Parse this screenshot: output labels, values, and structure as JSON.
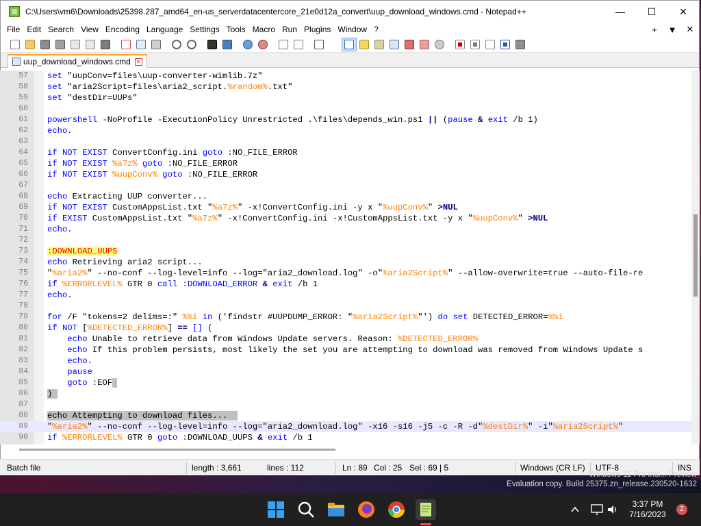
{
  "window": {
    "title": "C:\\Users\\vm6\\Downloads\\25398.287_amd64_en-us_serverdatacentercore_21e0d12a_convert\\uup_download_windows.cmd - Notepad++",
    "minimize": "—",
    "maximize": "☐",
    "close": "✕"
  },
  "menu": {
    "items": [
      "File",
      "Edit",
      "Search",
      "View",
      "Encoding",
      "Language",
      "Settings",
      "Tools",
      "Macro",
      "Run",
      "Plugins",
      "Window",
      "?"
    ],
    "right": [
      "+",
      "▼",
      "✕"
    ]
  },
  "toolbar": {
    "icons": [
      "new-file-icon",
      "open-file-icon",
      "save-icon",
      "save-all-icon",
      "close-icon",
      "close-all-icon",
      "print-icon",
      "cut-icon",
      "copy-icon",
      "paste-icon",
      "undo-icon",
      "redo-icon",
      "find-icon",
      "replace-icon",
      "zoom-in-icon",
      "zoom-out-icon",
      "sync-vertical-icon",
      "sync-horizontal-icon",
      "word-wrap-icon",
      "show-all-chars-icon",
      "indent-guide-icon",
      "udl-icon",
      "doc-map-icon",
      "function-list-icon",
      "folder-workspace-icon",
      "monitor-icon",
      "record-macro-icon",
      "stop-macro-icon",
      "play-macro-icon",
      "run-macro-multiple-icon",
      "save-macro-icon"
    ]
  },
  "tab": {
    "label": "uup_download_windows.cmd",
    "close": "✕"
  },
  "editor": {
    "lines": [
      {
        "n": "57",
        "segs": [
          [
            "kw",
            "set"
          ],
          [
            "t",
            " \"uupConv=files\\uup-converter-wimlib.7z\""
          ]
        ]
      },
      {
        "n": "58",
        "segs": [
          [
            "kw",
            "set"
          ],
          [
            "t",
            " \"aria2Script=files\\aria2_script."
          ],
          [
            "var",
            "%random%"
          ],
          [
            "t",
            ".txt\""
          ]
        ]
      },
      {
        "n": "59",
        "segs": [
          [
            "kw",
            "set"
          ],
          [
            "t",
            " \"destDir=UUPs\""
          ]
        ]
      },
      {
        "n": "60",
        "segs": []
      },
      {
        "n": "61",
        "segs": [
          [
            "kw",
            "powershell"
          ],
          [
            "t",
            " -NoProfile -ExecutionPolicy Unrestricted .\\files\\depends_win.ps1 "
          ],
          [
            "op",
            "||"
          ],
          [
            "t",
            " ("
          ],
          [
            "kw",
            "pause"
          ],
          [
            "t",
            " "
          ],
          [
            "op",
            "&"
          ],
          [
            "t",
            " "
          ],
          [
            "kw",
            "exit"
          ],
          [
            "t",
            " /b 1)"
          ]
        ]
      },
      {
        "n": "62",
        "segs": [
          [
            "kw",
            "echo"
          ],
          [
            "t",
            "."
          ]
        ]
      },
      {
        "n": "63",
        "segs": []
      },
      {
        "n": "64",
        "segs": [
          [
            "kw",
            "if NOT EXIST"
          ],
          [
            "t",
            " ConvertConfig.ini "
          ],
          [
            "kw",
            "goto"
          ],
          [
            "t",
            " :NO_FILE_ERROR"
          ]
        ]
      },
      {
        "n": "65",
        "segs": [
          [
            "kw",
            "if NOT EXIST"
          ],
          [
            "t",
            " "
          ],
          [
            "var",
            "%a7z%"
          ],
          [
            "t",
            " "
          ],
          [
            "kw",
            "goto"
          ],
          [
            "t",
            " :NO_FILE_ERROR"
          ]
        ]
      },
      {
        "n": "66",
        "segs": [
          [
            "kw",
            "if NOT EXIST"
          ],
          [
            "t",
            " "
          ],
          [
            "var",
            "%uupConv%"
          ],
          [
            "t",
            " "
          ],
          [
            "kw",
            "goto"
          ],
          [
            "t",
            " :NO_FILE_ERROR"
          ]
        ]
      },
      {
        "n": "67",
        "segs": []
      },
      {
        "n": "68",
        "segs": [
          [
            "kw",
            "echo"
          ],
          [
            "t",
            " Extracting UUP converter..."
          ]
        ]
      },
      {
        "n": "69",
        "segs": [
          [
            "kw",
            "if NOT EXIST"
          ],
          [
            "t",
            " CustomAppsList.txt \""
          ],
          [
            "var",
            "%a7z%"
          ],
          [
            "t",
            "\" -x!ConvertConfig.ini -y x \""
          ],
          [
            "var",
            "%uupConv%"
          ],
          [
            "t",
            "\" "
          ],
          [
            "op",
            ">NUL"
          ]
        ]
      },
      {
        "n": "70",
        "segs": [
          [
            "kw",
            "if EXIST"
          ],
          [
            "t",
            " CustomAppsList.txt \""
          ],
          [
            "var",
            "%a7z%"
          ],
          [
            "t",
            "\" -x!ConvertConfig.ini -x!CustomAppsList.txt -y x \""
          ],
          [
            "var",
            "%uupConv%"
          ],
          [
            "t",
            "\" "
          ],
          [
            "op",
            ">NUL"
          ]
        ]
      },
      {
        "n": "71",
        "segs": [
          [
            "kw",
            "echo"
          ],
          [
            "t",
            "."
          ]
        ]
      },
      {
        "n": "72",
        "segs": []
      },
      {
        "n": "73",
        "segs": [
          [
            "lbl",
            ":DOWNLOAD_UUPS"
          ]
        ]
      },
      {
        "n": "74",
        "segs": [
          [
            "kw",
            "echo"
          ],
          [
            "t",
            " Retrieving aria2 script..."
          ]
        ]
      },
      {
        "n": "75",
        "segs": [
          [
            "t",
            "\""
          ],
          [
            "var",
            "%aria2%"
          ],
          [
            "t",
            "\" --no-conf --log-level=info --log=\"aria2_download.log\" -o\""
          ],
          [
            "var",
            "%aria2Script%"
          ],
          [
            "t",
            "\" --allow-overwrite=true --auto-file-re"
          ]
        ]
      },
      {
        "n": "76",
        "segs": [
          [
            "kw",
            "if"
          ],
          [
            "t",
            " "
          ],
          [
            "var",
            "%ERRORLEVEL%"
          ],
          [
            "t",
            " GTR 0 "
          ],
          [
            "kw",
            "call"
          ],
          [
            "t",
            " "
          ],
          [
            "kw",
            ":DOWNLOAD_ERROR"
          ],
          [
            "t",
            " "
          ],
          [
            "op",
            "&"
          ],
          [
            "t",
            " "
          ],
          [
            "kw",
            "exit"
          ],
          [
            "t",
            " /b 1"
          ]
        ]
      },
      {
        "n": "77",
        "segs": [
          [
            "kw",
            "echo"
          ],
          [
            "t",
            "."
          ]
        ]
      },
      {
        "n": "78",
        "segs": []
      },
      {
        "n": "79",
        "segs": [
          [
            "kw",
            "for"
          ],
          [
            "t",
            " /F \"tokens=2 delims=:\" "
          ],
          [
            "var",
            "%%i"
          ],
          [
            "t",
            " "
          ],
          [
            "kw",
            "in"
          ],
          [
            "t",
            " ('findstr #UUPDUMP_ERROR: \""
          ],
          [
            "var",
            "%aria2Script%"
          ],
          [
            "t",
            "\"') "
          ],
          [
            "kw",
            "do set"
          ],
          [
            "t",
            " DETECTED_ERROR="
          ],
          [
            "var",
            "%%i"
          ]
        ]
      },
      {
        "n": "80",
        "segs": [
          [
            "kw",
            "if NOT"
          ],
          [
            "t",
            " ["
          ],
          [
            "var",
            "%DETECTED_ERROR%"
          ],
          [
            "t",
            "] "
          ],
          [
            "op",
            "=="
          ],
          [
            "t",
            " "
          ],
          [
            "kw",
            "[]"
          ],
          [
            "t",
            " ("
          ]
        ]
      },
      {
        "n": "81",
        "segs": [
          [
            "t",
            "    "
          ],
          [
            "kw",
            "echo"
          ],
          [
            "t",
            " Unable to retrieve data from Windows Update servers. Reason: "
          ],
          [
            "var",
            "%DETECTED_ERROR%"
          ]
        ]
      },
      {
        "n": "82",
        "segs": [
          [
            "t",
            "    "
          ],
          [
            "kw",
            "echo"
          ],
          [
            "t",
            " If this problem persists, most likely the set you are attempting to download was removed from Windows Update s"
          ]
        ]
      },
      {
        "n": "83",
        "segs": [
          [
            "t",
            "    "
          ],
          [
            "kw",
            "echo"
          ],
          [
            "t",
            "."
          ]
        ]
      },
      {
        "n": "84",
        "segs": [
          [
            "t",
            "    "
          ],
          [
            "kw",
            "pause"
          ]
        ]
      },
      {
        "n": "85",
        "segs": [
          [
            "t",
            "    "
          ],
          [
            "kw",
            "goto"
          ],
          [
            "t",
            " :EOF"
          ],
          [
            "sel",
            " "
          ]
        ]
      },
      {
        "n": "86",
        "segs": [
          [
            "sel",
            ")"
          ],
          [
            "sel",
            " "
          ]
        ]
      },
      {
        "n": "87",
        "segs": []
      },
      {
        "n": "88",
        "segs": [
          [
            "sel",
            "echo"
          ],
          [
            "sel",
            " Attempting to download files...  "
          ]
        ]
      },
      {
        "n": "89",
        "current": true,
        "segs": [
          [
            "t",
            "\""
          ],
          [
            "var",
            "%aria2%"
          ],
          [
            "t",
            "\" --no-conf --log-level=info --log=\"aria2_download.log\" -x16 -s16 -j5 -c -R -d\""
          ],
          [
            "var",
            "%destDir%"
          ],
          [
            "t",
            "\" -i\""
          ],
          [
            "var",
            "%aria2Script%"
          ],
          [
            "t",
            "\""
          ]
        ]
      },
      {
        "n": "90",
        "segs": [
          [
            "kw",
            "if"
          ],
          [
            "t",
            " "
          ],
          [
            "var",
            "%ERRORLEVEL%"
          ],
          [
            "t",
            " GTR 0 "
          ],
          [
            "kw",
            "goto"
          ],
          [
            "t",
            " :DOWNLOAD_UUPS "
          ],
          [
            "op",
            "&"
          ],
          [
            "t",
            " "
          ],
          [
            "kw",
            "exit"
          ],
          [
            "t",
            " /b 1"
          ]
        ]
      }
    ]
  },
  "status": {
    "type": "Batch file",
    "length": "length : 3,661",
    "lines": "lines : 112",
    "ln": "Ln : 89",
    "col": "Col : 25",
    "sel": "Sel : 69 | 5",
    "eol": "Windows (CR LF)",
    "encoding": "UTF-8",
    "mode": "INS"
  },
  "watermark": {
    "line1": "Windows 11 Pro Insi... Preview",
    "line2": "Evaluation copy. Build 25375.zn_release.230520-1632"
  },
  "taskbar": {
    "time": "3:37 PM",
    "date": "7/16/2023",
    "badge": "2",
    "apps": [
      "windows-start-icon",
      "search-icon",
      "file-explorer-icon",
      "firefox-icon",
      "chrome-icon",
      "notepadpp-icon"
    ]
  },
  "colors": {
    "keyword": "#0000ff",
    "variable": "#ff8000",
    "label_fg": "#ff0000",
    "label_bg": "#ffff80",
    "gutter": "#e4e4e4",
    "current_line": "#e8e8ff",
    "taskbar": "#202020"
  }
}
